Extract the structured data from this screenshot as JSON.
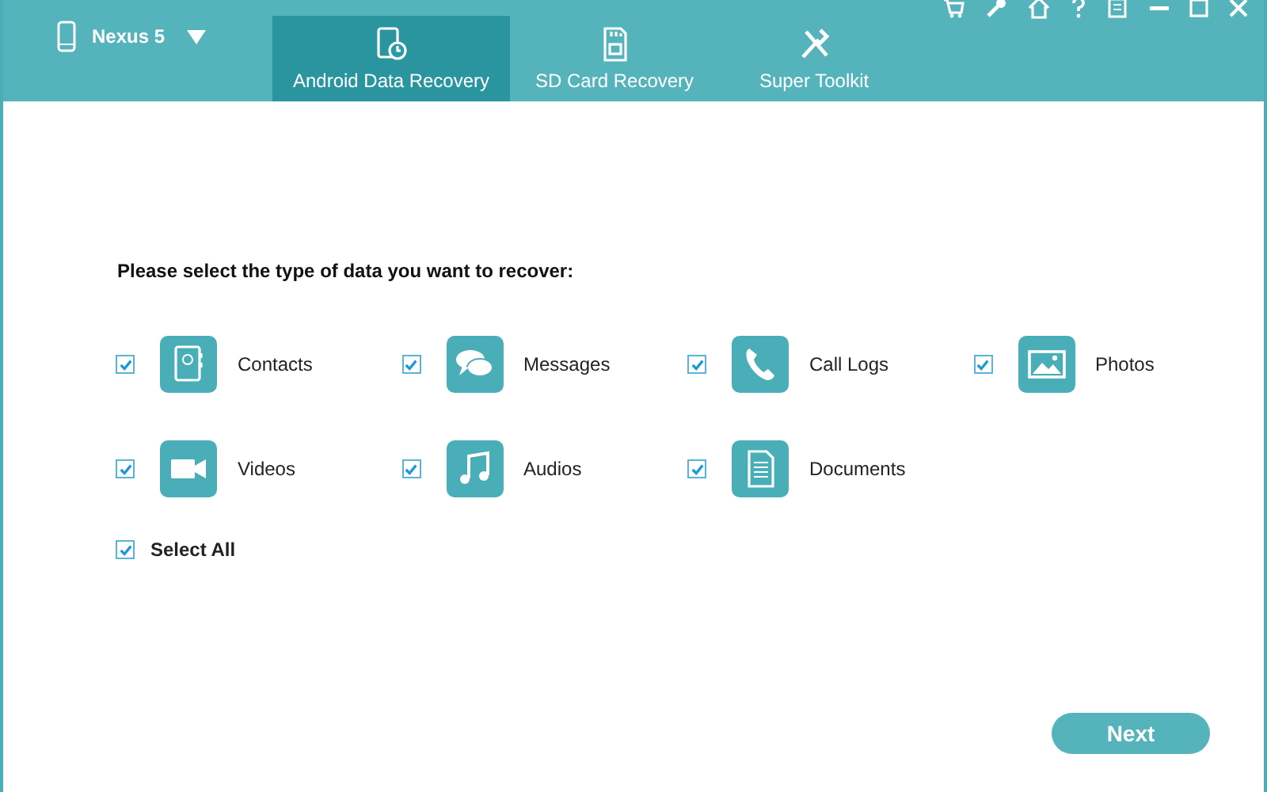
{
  "device": {
    "name": "Nexus 5"
  },
  "tabs": [
    {
      "label": "Android Data Recovery",
      "kind": "recovery",
      "selected": true
    },
    {
      "label": "SD Card Recovery",
      "kind": "sdcard",
      "selected": false
    },
    {
      "label": "Super Toolkit",
      "kind": "toolkit",
      "selected": false
    }
  ],
  "prompt": "Please select the type of data you want to recover:",
  "data_types": [
    {
      "label": "Contacts",
      "kind": "contacts",
      "checked": true
    },
    {
      "label": "Messages",
      "kind": "messages",
      "checked": true
    },
    {
      "label": "Call Logs",
      "kind": "calls",
      "checked": true
    },
    {
      "label": "Photos",
      "kind": "photos",
      "checked": true
    },
    {
      "label": "Videos",
      "kind": "videos",
      "checked": true
    },
    {
      "label": "Audios",
      "kind": "audios",
      "checked": true
    },
    {
      "label": "Documents",
      "kind": "documents",
      "checked": true
    }
  ],
  "select_all": {
    "label": "Select All",
    "checked": true
  },
  "next_button": "Next"
}
